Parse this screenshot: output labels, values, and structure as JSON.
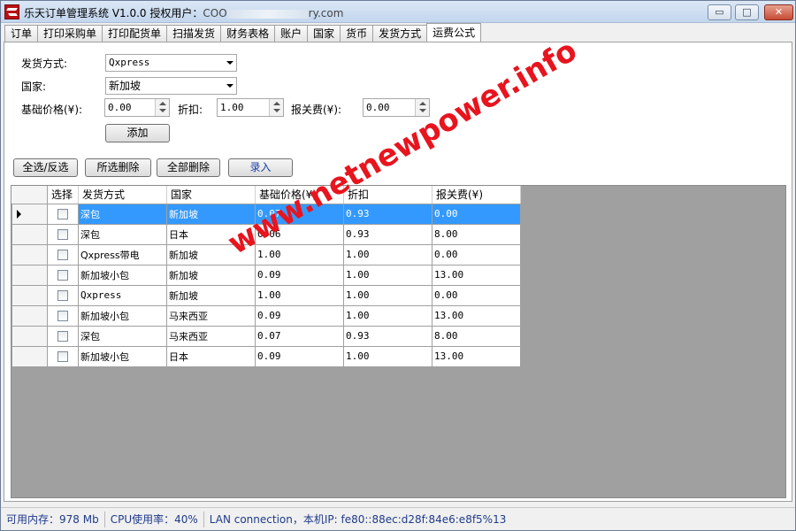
{
  "window": {
    "title_prefix": "乐天订单管理系统 V1.0.0 授权用户：",
    "title_user_visible_start": "COO",
    "title_user_visible_end": "ry.com",
    "minimize_label": "▭",
    "maximize_label": "□",
    "close_label": "✕"
  },
  "tabs": [
    "订单",
    "打印采购单",
    "打印配货单",
    "扫描发货",
    "财务表格",
    "账户",
    "国家",
    "货币",
    "发货方式",
    "运费公式"
  ],
  "active_tab_index": 9,
  "form": {
    "shipping_method_label": "发货方式:",
    "shipping_method_value": "Qxpress",
    "country_label": "国家:",
    "country_value": "新加坡",
    "base_price_label": "基础价格(¥):",
    "base_price_value": "0.00",
    "discount_label": "折扣:",
    "discount_value": "1.00",
    "customs_fee_label": "报关费(¥):",
    "customs_fee_value": "0.00",
    "add_button": "添加"
  },
  "toolbar": {
    "select_all_button": "全选/反选",
    "delete_selected_button": "所选删除",
    "delete_all_button": "全部删除",
    "enter_button": "录入"
  },
  "grid": {
    "columns": [
      "选择",
      "发货方式",
      "国家",
      "基础价格(¥)",
      "折扣",
      "报关费(¥)"
    ],
    "rows": [
      {
        "method": "深包",
        "country": "新加坡",
        "base": "0.07",
        "discount": "0.93",
        "fee": "0.00",
        "selected": true
      },
      {
        "method": "深包",
        "country": "日本",
        "base": "0.06",
        "discount": "0.93",
        "fee": "8.00",
        "selected": false
      },
      {
        "method": "Qxpress带电",
        "country": "新加坡",
        "base": "1.00",
        "discount": "1.00",
        "fee": "0.00",
        "selected": false
      },
      {
        "method": "新加坡小包",
        "country": "新加坡",
        "base": "0.09",
        "discount": "1.00",
        "fee": "13.00",
        "selected": false
      },
      {
        "method": "Qxpress",
        "country": "新加坡",
        "base": "1.00",
        "discount": "1.00",
        "fee": "0.00",
        "selected": false
      },
      {
        "method": "新加坡小包",
        "country": "马来西亚",
        "base": "0.09",
        "discount": "1.00",
        "fee": "13.00",
        "selected": false
      },
      {
        "method": "深包",
        "country": "马来西亚",
        "base": "0.07",
        "discount": "0.93",
        "fee": "8.00",
        "selected": false
      },
      {
        "method": "新加坡小包",
        "country": "日本",
        "base": "0.09",
        "discount": "1.00",
        "fee": "13.00",
        "selected": false
      }
    ]
  },
  "watermark": "www.netnewpower.info",
  "status": {
    "memory": "可用内存：978 Mb",
    "cpu": "CPU使用率：40%",
    "network": "LAN connection，本机IP: fe80::88ec:d28f:84e6:e8f5%13"
  },
  "colors": {
    "selected_row": "#3399ff",
    "grid_background": "#a0a0a0",
    "watermark": "#e8141e",
    "status_text": "#1f3a8a"
  }
}
